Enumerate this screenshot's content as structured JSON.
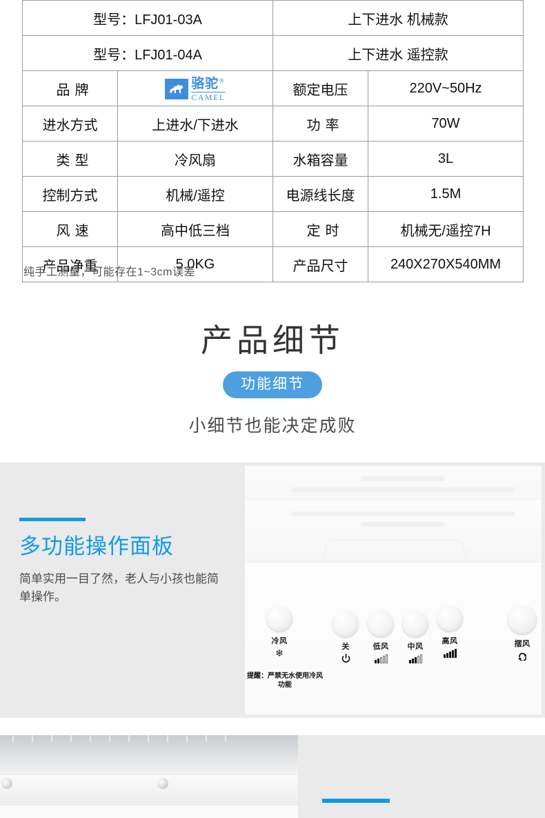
{
  "spec_table": {
    "model_rows": [
      {
        "label": "型号：LFJ01-03A",
        "value": "上下进水  机械款"
      },
      {
        "label": "型号：LFJ01-04A",
        "value": "上下进水  遥控款"
      }
    ],
    "rows": [
      {
        "left_label": "品牌",
        "left_label_a": "品",
        "left_label_b": "牌",
        "left_value": "CAMEL-LOGO",
        "brand_cn": "骆驼",
        "brand_reg": "®",
        "brand_en": "CAMEL",
        "right_label": "额定电压",
        "right_value": "220V~50Hz"
      },
      {
        "left_label": "进水方式",
        "left_value": "上进水/下进水",
        "right_label_a": "功",
        "right_label_b": "率",
        "right_label": "功率",
        "right_value": "70W"
      },
      {
        "left_label_a": "类",
        "left_label_b": "型",
        "left_label": "类型",
        "left_value": "冷风扇",
        "right_label": "水箱容量",
        "right_value": "3L"
      },
      {
        "left_label": "控制方式",
        "left_value": "机械/遥控",
        "right_label": "电源线长度",
        "right_value": "1.5M"
      },
      {
        "left_label_a": "风",
        "left_label_b": "速",
        "left_label": "风速",
        "left_value": "高中低三档",
        "right_label_a": "定",
        "right_label_b": "时",
        "right_label": "定时",
        "right_value": "机械无/遥控7H"
      },
      {
        "left_label": "产品净重",
        "left_value": "5.0KG",
        "right_label": "产品尺寸",
        "right_value": "240X270X540MM"
      }
    ],
    "note": "纯手工测量，可能存在1~3cm误差"
  },
  "detail_section": {
    "title": "产品细节",
    "pill": "功能细节",
    "subtitle": "小细节也能决定成败"
  },
  "feature_panel": {
    "title": "多功能操作面板",
    "description": "简单实用一目了然，老人与小孩也能简单操作。",
    "warning": "提醒：严禁无水使用冷风功能",
    "controls": [
      {
        "label": "冷风",
        "icon": "snowflake-icon",
        "glyph": "❄",
        "bars_on": 0,
        "bars_total": 0
      },
      {
        "label": "关",
        "icon": "power-icon",
        "glyph": "⏻",
        "bars_on": 0,
        "bars_total": 0
      },
      {
        "label": "低风",
        "icon": "signal-bars-low-icon",
        "glyph": "",
        "bars_on": 2,
        "bars_total": 5
      },
      {
        "label": "中风",
        "icon": "signal-bars-medium-icon",
        "glyph": "",
        "bars_on": 3,
        "bars_total": 5
      },
      {
        "label": "高风",
        "icon": "signal-bars-high-icon",
        "glyph": "",
        "bars_on": 5,
        "bars_total": 5
      },
      {
        "label": "摆风",
        "icon": "swing-rotate-icon",
        "glyph": "↻",
        "bars_on": 0,
        "bars_total": 0
      }
    ]
  },
  "colors": {
    "accent_blue": "#0f9ae8",
    "brand_blue": "#3f8edc",
    "pill_blue": "#4e9fe0",
    "band_gray": "#eaeaea",
    "title_gray": "#333333"
  }
}
